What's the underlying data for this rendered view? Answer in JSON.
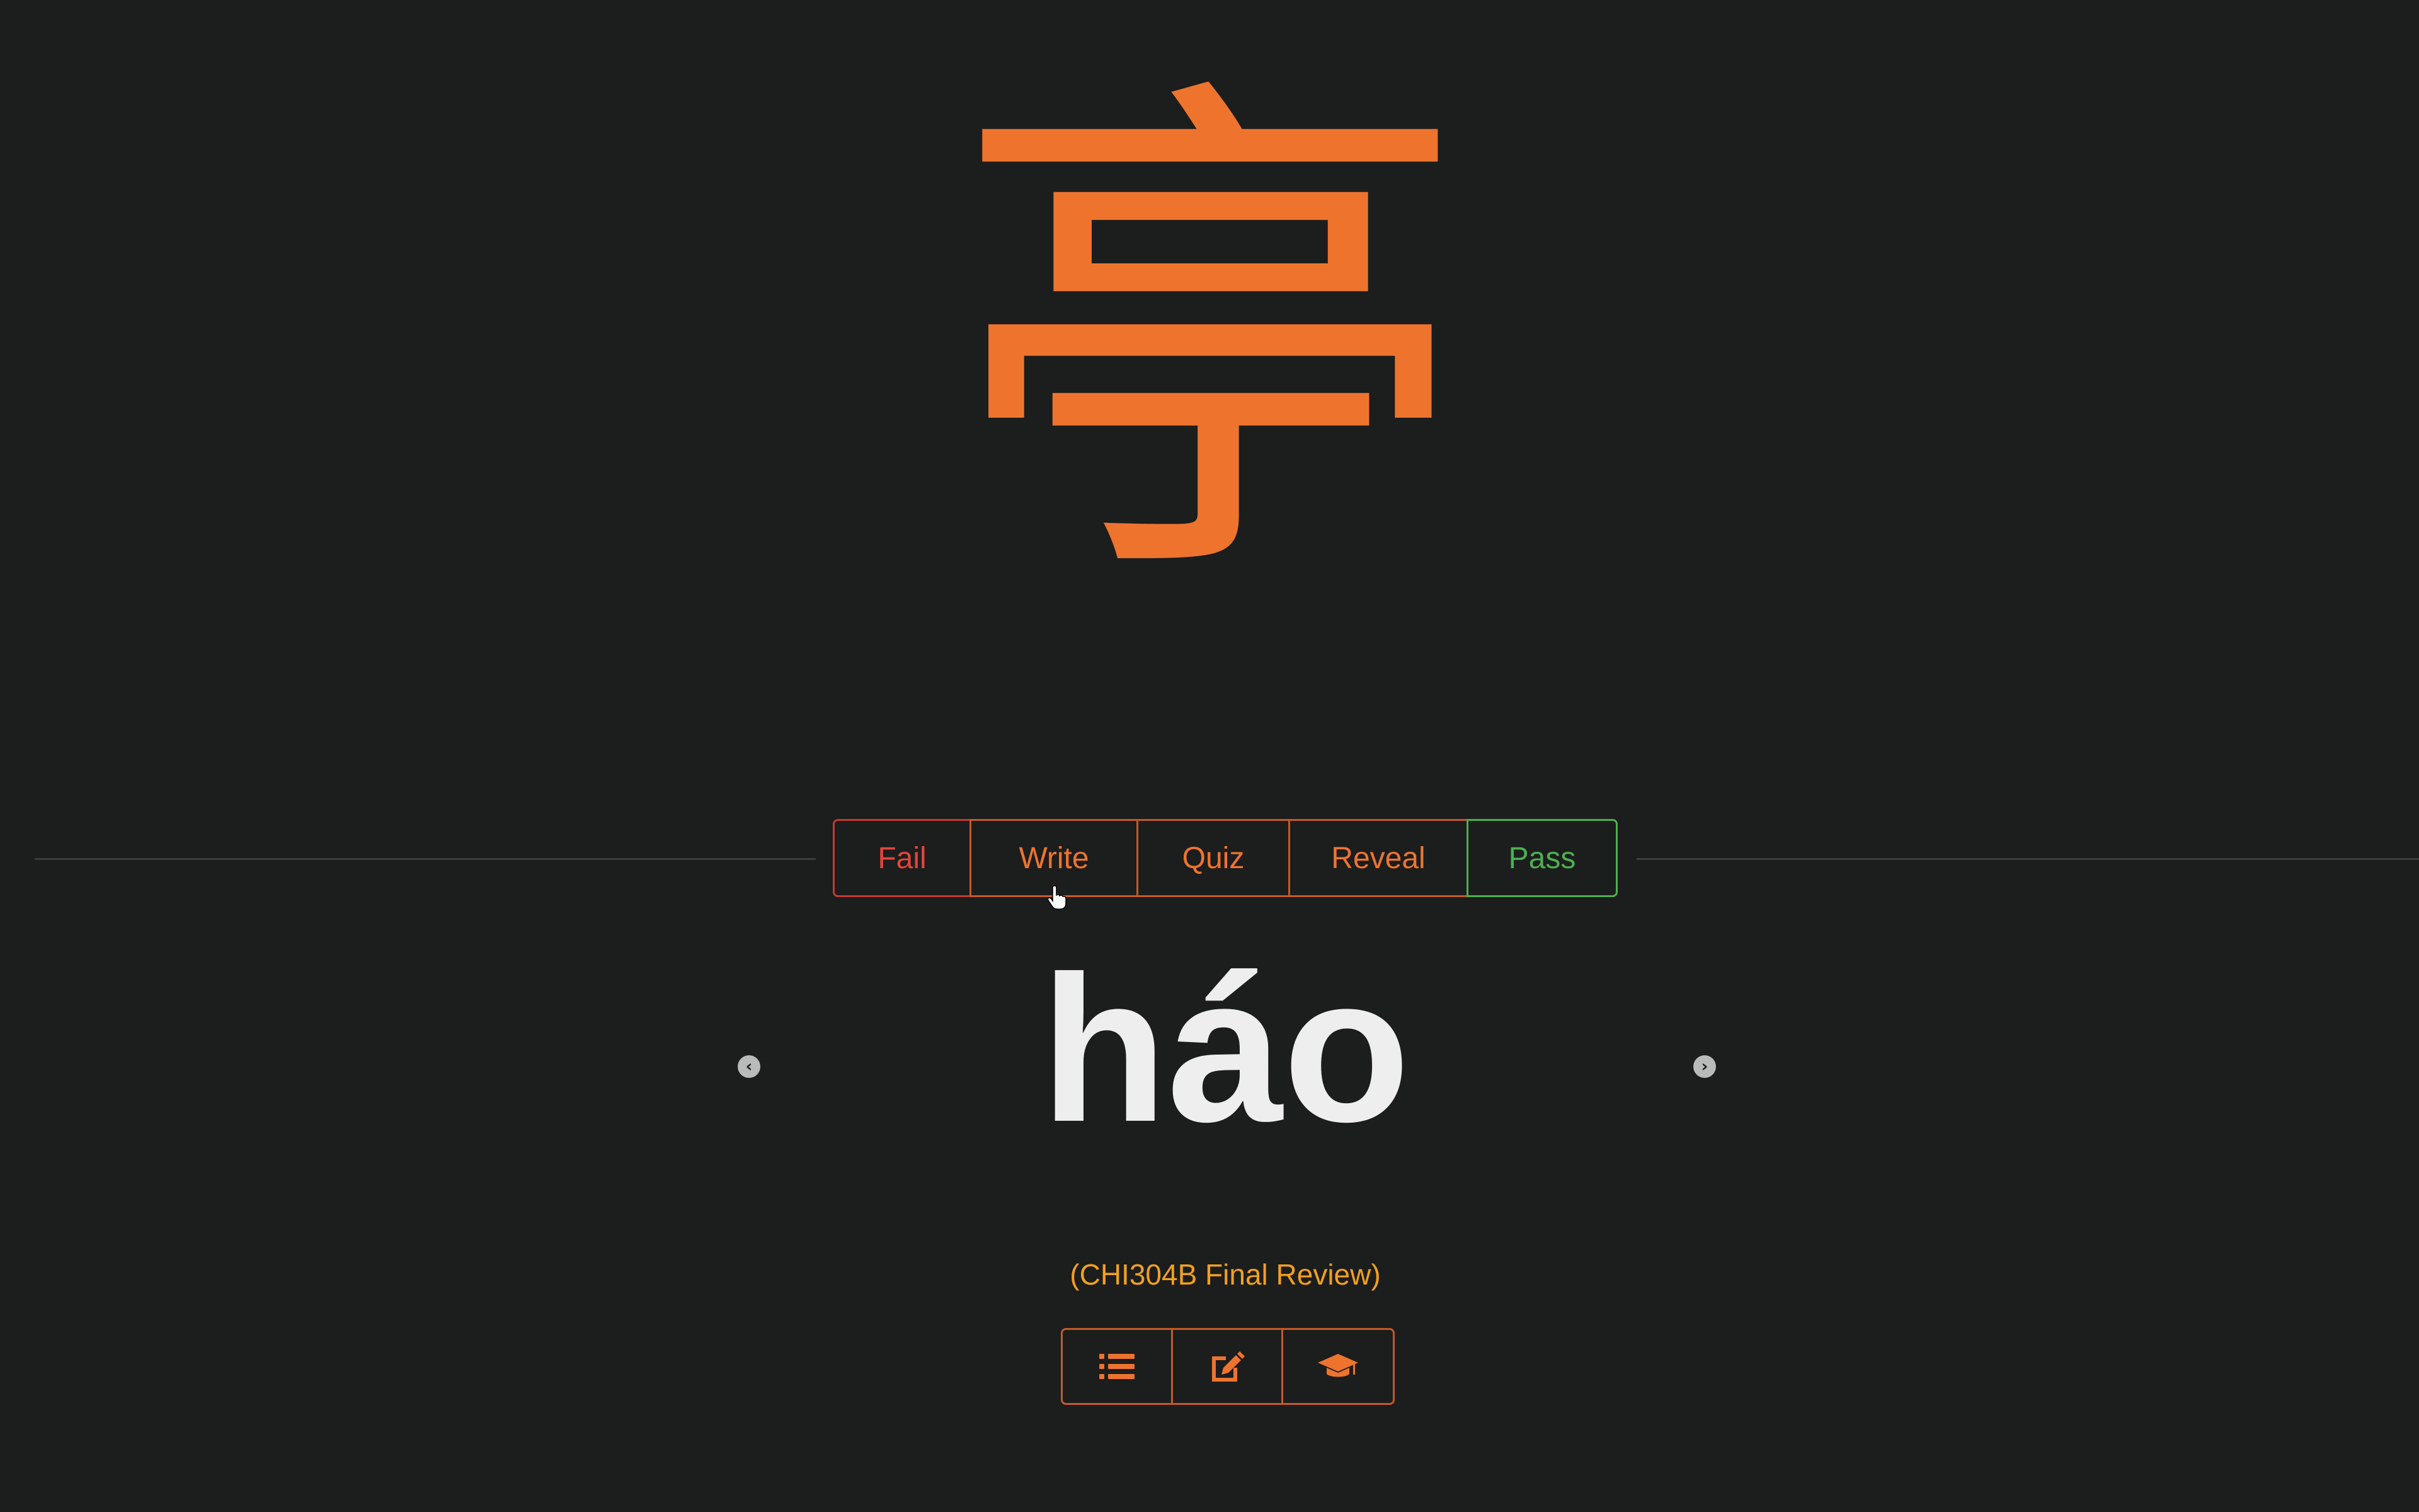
{
  "card": {
    "character": "亭",
    "pinyin": "háo",
    "deck_label": "(CHI304B Final Review)"
  },
  "actions": {
    "fail": "Fail",
    "write": "Write",
    "quiz": "Quiz",
    "reveal": "Reveal",
    "pass": "Pass"
  },
  "navigation": {
    "prev_icon": "chevron-left-circle-icon",
    "next_icon": "chevron-right-circle-icon"
  },
  "toolbar_icons": [
    "list-icon",
    "edit-icon",
    "graduation-cap-icon"
  ],
  "colors": {
    "background": "#1c1d1d",
    "accent": "#ee742e",
    "fail": "#e3453b",
    "pass": "#4caf50",
    "deck_label": "#f0a020",
    "pinyin": "#eeeeee"
  }
}
